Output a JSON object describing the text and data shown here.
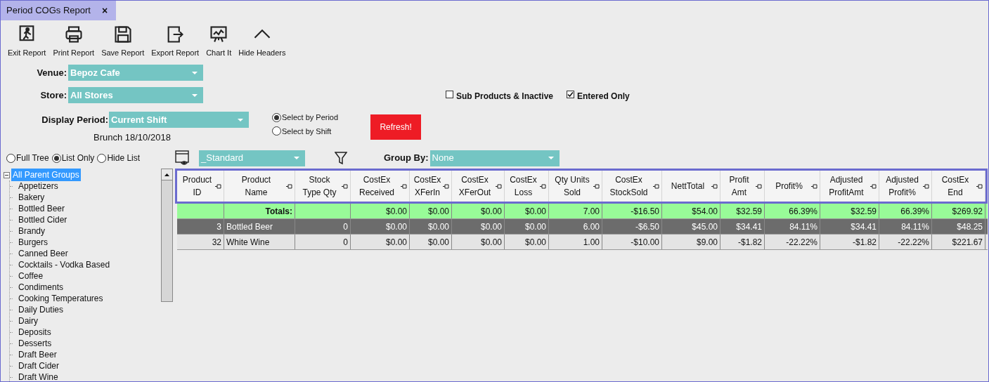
{
  "tab": {
    "title": "Period COGs Report",
    "close": "×"
  },
  "toolbar": [
    {
      "kind": "exit",
      "label": "Exit Report"
    },
    {
      "kind": "print",
      "label": "Print Report"
    },
    {
      "kind": "save",
      "label": "Save Report"
    },
    {
      "kind": "export",
      "label": "Export Report"
    },
    {
      "kind": "chart",
      "label": "Chart It"
    },
    {
      "kind": "collapse",
      "label": "Hide Headers"
    }
  ],
  "venue": {
    "label": "Venue:",
    "value": "Bepoz Cafe"
  },
  "store": {
    "label": "Store:",
    "value": "All Stores"
  },
  "display_period": {
    "label": "Display Period:",
    "value": "Current Shift",
    "caption": "Brunch 18/10/2018"
  },
  "period_mode": [
    {
      "label": "Select by Period",
      "selected": true
    },
    {
      "label": "Select by Shift",
      "selected": false
    }
  ],
  "refresh_button": "Refresh!",
  "options": [
    {
      "label": "Sub Products & Inactive",
      "checked": false
    },
    {
      "label": "Entered Only",
      "checked": true
    }
  ],
  "tree_mode": [
    {
      "label": "Full Tree",
      "selected": false
    },
    {
      "label": "List Only",
      "selected": true
    },
    {
      "label": "Hide List",
      "selected": false
    }
  ],
  "layout": {
    "value": "_Standard"
  },
  "group_by": {
    "label": "Group By:",
    "value": "None"
  },
  "tree": {
    "label": "All Parent Groups",
    "selected": true,
    "expanded": true,
    "children": [
      {
        "label": "Appetizers",
        "selected": false
      },
      {
        "label": "Bakery",
        "selected": false
      },
      {
        "label": "Bottled Beer",
        "selected": false
      },
      {
        "label": "Bottled Cider",
        "selected": false
      },
      {
        "label": "Brandy",
        "selected": false
      },
      {
        "label": "Burgers",
        "selected": false
      },
      {
        "label": "Canned Beer",
        "selected": false
      },
      {
        "label": "Cocktails - Vodka Based",
        "selected": false
      },
      {
        "label": "Coffee",
        "selected": false
      },
      {
        "label": "Condiments",
        "selected": false
      },
      {
        "label": "Cooking Temperatures",
        "selected": false
      },
      {
        "label": "Daily Duties",
        "selected": false
      },
      {
        "label": "Dairy",
        "selected": false
      },
      {
        "label": "Deposits",
        "selected": false
      },
      {
        "label": "Desserts",
        "selected": false
      },
      {
        "label": "Draft Beer",
        "selected": false
      },
      {
        "label": "Draft Cider",
        "selected": false
      },
      {
        "label": "Draft Wine",
        "selected": false
      }
    ]
  },
  "table": {
    "columns": [
      "Product\nID",
      "Product\nName",
      "Stock\nType Qty",
      "CostEx\nReceived",
      "CostEx\nXFerIn",
      "CostEx\nXFerOut",
      "CostEx\nLoss",
      "Qty Units\nSold",
      "CostEx\nStockSold",
      "NettTotal",
      "Profit\nAmt",
      "Profit%",
      "Adjusted\nProfitAmt",
      "Adjusted\nProfit%",
      "CostEx\nEnd"
    ],
    "rows": [
      {
        "kind": "totals",
        "selected": false,
        "cells": [
          "",
          "Totals:",
          "",
          "$0.00",
          "$0.00",
          "$0.00",
          "$0.00",
          "7.00",
          "-$16.50",
          "$54.00",
          "$32.59",
          "66.39%",
          "$32.59",
          "66.39%",
          "$269.92"
        ]
      },
      {
        "kind": "data",
        "selected": true,
        "cells": [
          "3",
          "Bottled Beer",
          "0",
          "$0.00",
          "$0.00",
          "$0.00",
          "$0.00",
          "6.00",
          "-$6.50",
          "$45.00",
          "$34.41",
          "84.11%",
          "$34.41",
          "84.11%",
          "$48.25"
        ]
      },
      {
        "kind": "data",
        "selected": false,
        "cells": [
          "32",
          "White Wine",
          "0",
          "$0.00",
          "$0.00",
          "$0.00",
          "$0.00",
          "1.00",
          "-$10.00",
          "$9.00",
          "-$1.82",
          "-22.22%",
          "-$1.82",
          "-22.22%",
          "$221.67"
        ]
      }
    ]
  }
}
